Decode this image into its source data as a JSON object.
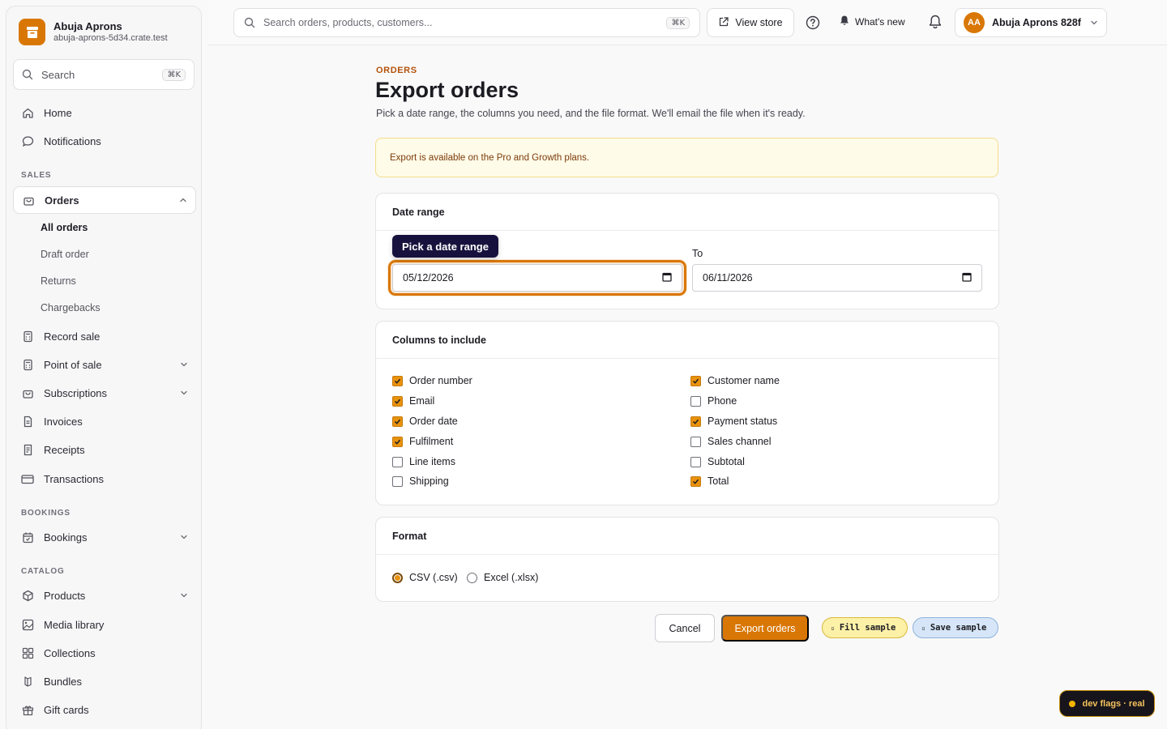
{
  "brand": {
    "name": "Abuja Aprons",
    "domain": "abuja-aprons-5d34.crate.test"
  },
  "sidebar": {
    "search_label": "Search",
    "search_shortcut": "⌘K",
    "home": "Home",
    "notifications": "Notifications",
    "section_sales": "SALES",
    "orders": "Orders",
    "orders_sub": [
      "All orders",
      "Draft order",
      "Returns",
      "Chargebacks"
    ],
    "record_sale": "Record sale",
    "point_of_sale": "Point of sale",
    "subscriptions": "Subscriptions",
    "invoices": "Invoices",
    "receipts": "Receipts",
    "transactions": "Transactions",
    "section_bookings": "BOOKINGS",
    "bookings": "Bookings",
    "section_catalog": "CATALOG",
    "products": "Products",
    "media_library": "Media library",
    "collections": "Collections",
    "bundles": "Bundles",
    "gift_cards": "Gift cards"
  },
  "topbar": {
    "search_placeholder": "Search orders, products, customers...",
    "search_shortcut": "⌘K",
    "view_store": "View store",
    "whats_new": "What's new",
    "avatar_initials": "AA",
    "user_name": "Abuja Aprons 828f"
  },
  "page": {
    "eyebrow": "ORDERS",
    "title": "Export orders",
    "description": "Pick a date range, the columns you need, and the file format. We'll email the file when it's ready.",
    "alert": "Export is available on the Pro and Growth plans."
  },
  "date_range": {
    "heading": "Date range",
    "tooltip": "Pick a date range",
    "from_value": "05/12/2026",
    "to_label": "To",
    "to_value": "06/11/2026"
  },
  "columns": {
    "heading": "Columns to include",
    "left": [
      {
        "label": "Order number",
        "checked": true
      },
      {
        "label": "Email",
        "checked": true
      },
      {
        "label": "Order date",
        "checked": true
      },
      {
        "label": "Fulfilment",
        "checked": true
      },
      {
        "label": "Line items",
        "checked": false
      },
      {
        "label": "Shipping",
        "checked": false
      }
    ],
    "right": [
      {
        "label": "Customer name",
        "checked": true
      },
      {
        "label": "Phone",
        "checked": false
      },
      {
        "label": "Payment status",
        "checked": true
      },
      {
        "label": "Sales channel",
        "checked": false
      },
      {
        "label": "Subtotal",
        "checked": false
      },
      {
        "label": "Total",
        "checked": true
      }
    ]
  },
  "format": {
    "heading": "Format",
    "options": [
      {
        "label": "CSV (.csv)",
        "selected": true
      },
      {
        "label": "Excel (.xlsx)",
        "selected": false
      }
    ]
  },
  "actions": {
    "cancel": "Cancel",
    "export": "Export orders",
    "fill_sample": "Fill sample",
    "save_sample": "Save sample"
  },
  "dev_flags": "dev flags · real",
  "colors": {
    "accent": "#d97706",
    "tooltip_bg": "#17123d",
    "alert_bg": "#fefbe8"
  }
}
